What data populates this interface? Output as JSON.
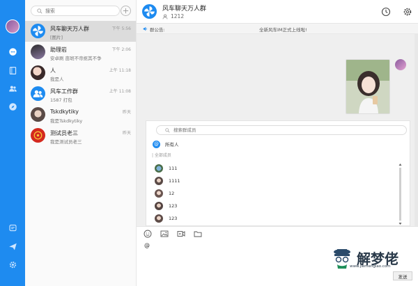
{
  "search": {
    "placeholder": "搜索"
  },
  "conversations": [
    {
      "name": "风车聊天万人群",
      "sub": "[图片]",
      "time": "下午 5:56"
    },
    {
      "name": "助理岩",
      "sub": "安卓刷 亩斑不帝抠其不争",
      "time": "下午 2:06"
    },
    {
      "name": "人",
      "sub": "我是人",
      "time": "上午 11:18"
    },
    {
      "name": "风车工作群",
      "sub": "1587 打包",
      "time": "上午 11:08"
    },
    {
      "name": "Tskdkytiky",
      "sub": "我是Tskdkytiky",
      "time": "昨天"
    },
    {
      "name": "测试员老三",
      "sub": "我是测试员老三",
      "time": "昨天"
    }
  ],
  "chat": {
    "title": "风车聊天万人群",
    "member_count": "1212",
    "notice_label": "群公告:",
    "notice_text": "全新风车IM正式上线啦!"
  },
  "mention": {
    "placeholder": "搜索群成员",
    "all_label": "所有人",
    "section_label": "| 全部成员",
    "members": [
      "111",
      "1111",
      "12",
      "123",
      "123"
    ]
  },
  "composer": {
    "text": "@",
    "send_label": "发送"
  },
  "watermark": {
    "title": "解梦佬",
    "url": "www.jiemenglao.com"
  },
  "colors": {
    "accent": "#1e8bf0",
    "active_row": "#dcdcdc"
  }
}
